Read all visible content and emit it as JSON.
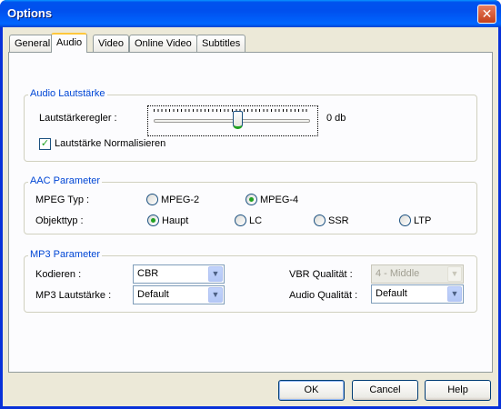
{
  "window": {
    "title": "Options",
    "close_symbol": "✕"
  },
  "tabs": [
    {
      "label": "General"
    },
    {
      "label": "Audio",
      "active": true
    },
    {
      "label": "Video"
    },
    {
      "label": "Online Video"
    },
    {
      "label": "Subtitles"
    }
  ],
  "audio_volume": {
    "legend": "Audio Lautstärke",
    "slider_label": "Lautstärkeregler :",
    "slider_value": "0 db",
    "slider_position": 0.5,
    "normalize_label": "Lautstärke Normalisieren",
    "normalize_checked": true
  },
  "aac": {
    "legend": "AAC Parameter",
    "mpeg_type_label": "MPEG Typ :",
    "mpeg_options": [
      "MPEG-2",
      "MPEG-4"
    ],
    "mpeg_selected": "MPEG-4",
    "object_type_label": "Objekttyp :",
    "object_options": [
      "Haupt",
      "LC",
      "SSR",
      "LTP"
    ],
    "object_selected": "Haupt"
  },
  "mp3": {
    "legend": "MP3 Parameter",
    "encode_label": "Kodieren :",
    "encode_value": "CBR",
    "volume_label": "MP3 Lautstärke :",
    "volume_value": "Default",
    "vbr_label": "VBR Qualität :",
    "vbr_value": "4 - Middle",
    "vbr_disabled": true,
    "audio_quality_label": "Audio Qualität :",
    "audio_quality_value": "Default"
  },
  "buttons": {
    "ok": "OK",
    "cancel": "Cancel",
    "help": "Help"
  },
  "colors": {
    "accent": "#0046d5",
    "titlebar": "#0050ee",
    "check": "#21a121",
    "face": "#ece9d8"
  }
}
